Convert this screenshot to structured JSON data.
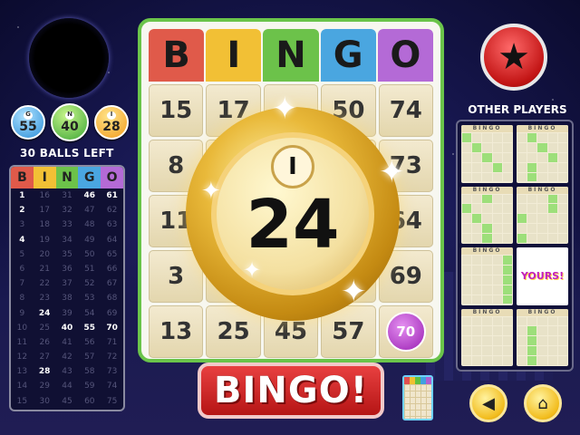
{
  "called_balls": [
    {
      "letter": "G",
      "number": "55"
    },
    {
      "letter": "N",
      "number": "40"
    },
    {
      "letter": "I",
      "number": "28"
    }
  ],
  "balls_left_text": "30 BALLS LEFT",
  "board": {
    "header": [
      "B",
      "I",
      "N",
      "G",
      "O"
    ],
    "rows": [
      [
        "1",
        "16",
        "31",
        "46",
        "61"
      ],
      [
        "2",
        "17",
        "32",
        "47",
        "62"
      ],
      [
        "3",
        "18",
        "33",
        "48",
        "63"
      ],
      [
        "4",
        "19",
        "34",
        "49",
        "64"
      ],
      [
        "5",
        "20",
        "35",
        "50",
        "65"
      ],
      [
        "6",
        "21",
        "36",
        "51",
        "66"
      ],
      [
        "7",
        "22",
        "37",
        "52",
        "67"
      ],
      [
        "8",
        "23",
        "38",
        "53",
        "68"
      ],
      [
        "9",
        "24",
        "39",
        "54",
        "69"
      ],
      [
        "10",
        "25",
        "40",
        "55",
        "70"
      ],
      [
        "11",
        "26",
        "41",
        "56",
        "71"
      ],
      [
        "12",
        "27",
        "42",
        "57",
        "72"
      ],
      [
        "13",
        "28",
        "43",
        "58",
        "73"
      ],
      [
        "14",
        "29",
        "44",
        "59",
        "74"
      ],
      [
        "15",
        "30",
        "45",
        "60",
        "75"
      ]
    ],
    "hits": [
      "1",
      "2",
      "4",
      "24",
      "40",
      "55",
      "70",
      "28",
      "46",
      "61"
    ]
  },
  "card": {
    "header": [
      "B",
      "I",
      "N",
      "G",
      "O"
    ],
    "header_colors": [
      "#e05a4a",
      "#f2c035",
      "#6cc24a",
      "#4aa6e0",
      "#b46ad6"
    ],
    "cells": [
      [
        "15",
        "17",
        "",
        "50",
        "74"
      ],
      [
        "8",
        "",
        "",
        "",
        "73"
      ],
      [
        "11",
        "",
        "",
        "",
        "64"
      ],
      [
        "3",
        "",
        "",
        "",
        "69"
      ],
      [
        "13",
        "25",
        "45",
        "57",
        "70"
      ]
    ],
    "marked": [
      "70"
    ]
  },
  "current_ball": {
    "letter": "I",
    "number": "24"
  },
  "bingo_button": "BINGO!",
  "other_players_title": "OTHER PLAYERS",
  "other_player_card_header": "BINGO",
  "yours_label": "YOURS!",
  "icons": {
    "star": "star-icon",
    "sound": "speaker-icon",
    "home": "home-icon"
  }
}
